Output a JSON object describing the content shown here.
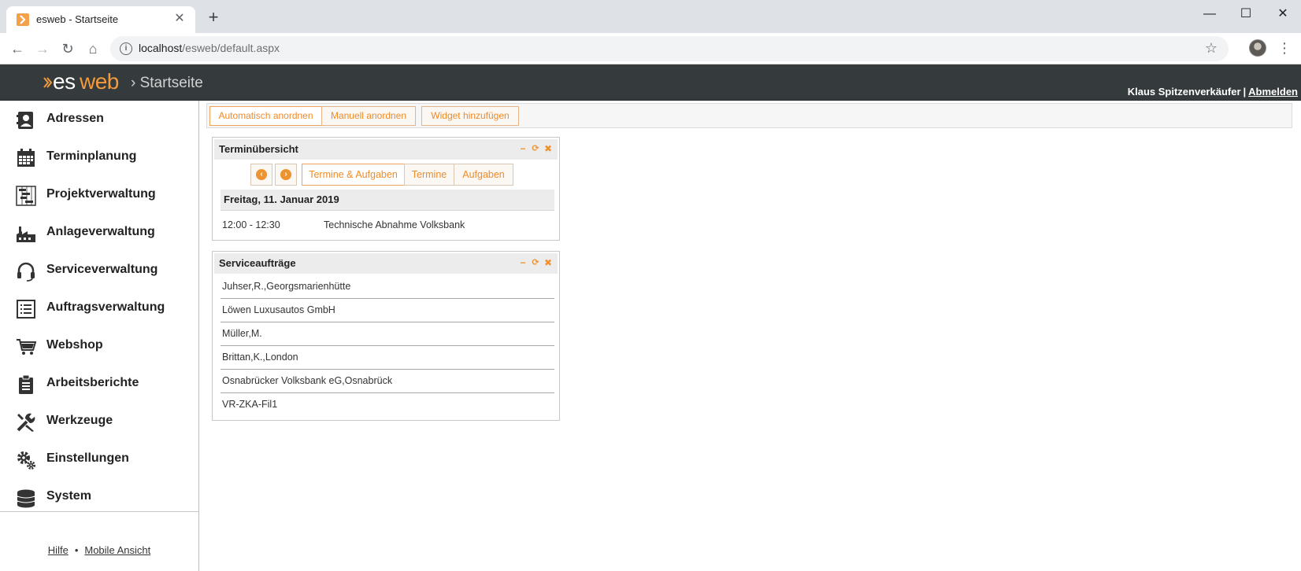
{
  "browser": {
    "tab_title": "esweb - Startseite",
    "tab_close": "✕",
    "new_tab": "+",
    "url_host": "localhost",
    "url_path": "/esweb/default.aspx",
    "window_controls": {
      "minimize": "—",
      "maximize": "☐",
      "close": "✕"
    },
    "nav": {
      "back": "←",
      "forward": "→",
      "reload": "↻",
      "home": "⌂"
    },
    "star": "☆",
    "menu": "⋮"
  },
  "app": {
    "logo_es": "es",
    "logo_web": "web",
    "breadcrumb": "› Startseite",
    "user_name": "Klaus Spitzenverkäufer",
    "user_sep": "|",
    "logout": "Abmelden",
    "accent_color": "#f39a3c"
  },
  "sidebar": {
    "items": [
      {
        "label": "Adressen",
        "icon": "address-book-icon"
      },
      {
        "label": "Terminplanung",
        "icon": "calendar-icon"
      },
      {
        "label": "Projektverwaltung",
        "icon": "gantt-icon"
      },
      {
        "label": "Anlageverwaltung",
        "icon": "factory-icon"
      },
      {
        "label": "Serviceverwaltung",
        "icon": "headset-icon"
      },
      {
        "label": "Auftragsverwaltung",
        "icon": "list-icon"
      },
      {
        "label": "Webshop",
        "icon": "cart-icon"
      },
      {
        "label": "Arbeitsberichte",
        "icon": "clipboard-icon"
      },
      {
        "label": "Werkzeuge",
        "icon": "tools-icon"
      },
      {
        "label": "Einstellungen",
        "icon": "gears-icon"
      },
      {
        "label": "System",
        "icon": "database-icon"
      }
    ],
    "footer": {
      "help": "Hilfe",
      "dot": "•",
      "mobile": "Mobile Ansicht"
    }
  },
  "toolbar": {
    "auto_arrange": "Automatisch anordnen",
    "manual_arrange": "Manuell anordnen",
    "add_widget": "Widget hinzufügen"
  },
  "widgets": {
    "terminuebersicht": {
      "title": "Terminübersicht",
      "prev": "‹",
      "next": "›",
      "filters": [
        "Termine & Aufgaben",
        "Termine",
        "Aufgaben"
      ],
      "day": "Freitag, 11. Januar 2019",
      "appointments": [
        {
          "time": "12:00 - 12:30",
          "title": "Technische Abnahme Volksbank"
        }
      ]
    },
    "serviceauftraege": {
      "title": "Serviceaufträge",
      "items": [
        "Juhser,R.,Georgsmarienhütte",
        "Löwen Luxusautos GmbH",
        "Müller,M.",
        "Brittan,K.,London",
        "Osnabrücker Volksbank eG,Osnabrück",
        "VR-ZKA-Fil1"
      ]
    },
    "tools": {
      "minimize": "−",
      "refresh": "⟳",
      "close": "✖"
    }
  }
}
